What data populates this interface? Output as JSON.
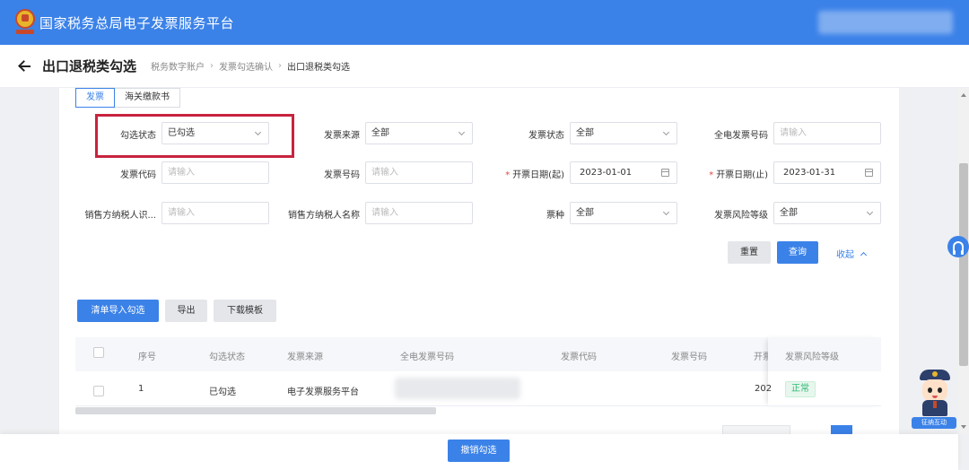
{
  "app": {
    "title": "国家税务总局电子发票服务平台"
  },
  "header": {
    "page_title": "出口退税类勾选",
    "breadcrumb": [
      "税务数字账户",
      "发票勾选确认",
      "出口退税类勾选"
    ]
  },
  "tabs": [
    {
      "label": "发票",
      "active": true
    },
    {
      "label": "海关缴款书",
      "active": false
    }
  ],
  "filters": {
    "check_status": {
      "label": "勾选状态",
      "value": "已勾选"
    },
    "invoice_source": {
      "label": "发票来源",
      "value": "全部"
    },
    "invoice_status": {
      "label": "发票状态",
      "value": "全部"
    },
    "full_invoice_no": {
      "label": "全电发票号码",
      "placeholder": "请输入"
    },
    "invoice_code": {
      "label": "发票代码",
      "placeholder": "请输入"
    },
    "invoice_no": {
      "label": "发票号码",
      "placeholder": "请输入"
    },
    "date_start": {
      "label": "开票日期(起)",
      "value": "2023-01-01",
      "required": "*"
    },
    "date_end": {
      "label": "开票日期(止)",
      "value": "2023-01-31",
      "required": "*"
    },
    "seller_tax_id": {
      "label": "销售方纳税人识...",
      "placeholder": "请输入"
    },
    "seller_name": {
      "label": "销售方纳税人名称",
      "placeholder": "请输入"
    },
    "ticket_type": {
      "label": "票种",
      "value": "全部"
    },
    "risk_level": {
      "label": "发票风险等级",
      "value": "全部"
    }
  },
  "actions": {
    "reset": "重置",
    "query": "查询",
    "collapse": "收起"
  },
  "toolbar": {
    "import_check": "清单导入勾选",
    "export": "导出",
    "download_template": "下载模板"
  },
  "table": {
    "columns": [
      "序号",
      "勾选状态",
      "发票来源",
      "全电发票号码",
      "发票代码",
      "发票号码",
      "开票",
      "发票风险等级"
    ],
    "rows": [
      {
        "index": "1",
        "check_status": "已勾选",
        "source": "电子发票服务平台",
        "date_partial": "202",
        "risk": "正常"
      }
    ]
  },
  "footer": {
    "cancel_check": "撤销勾选"
  },
  "support": {
    "mascot_label": "征纳互动"
  },
  "colors": {
    "brand": "#3b82e8",
    "highlight": "#c8233f",
    "success": "#2eb872"
  }
}
